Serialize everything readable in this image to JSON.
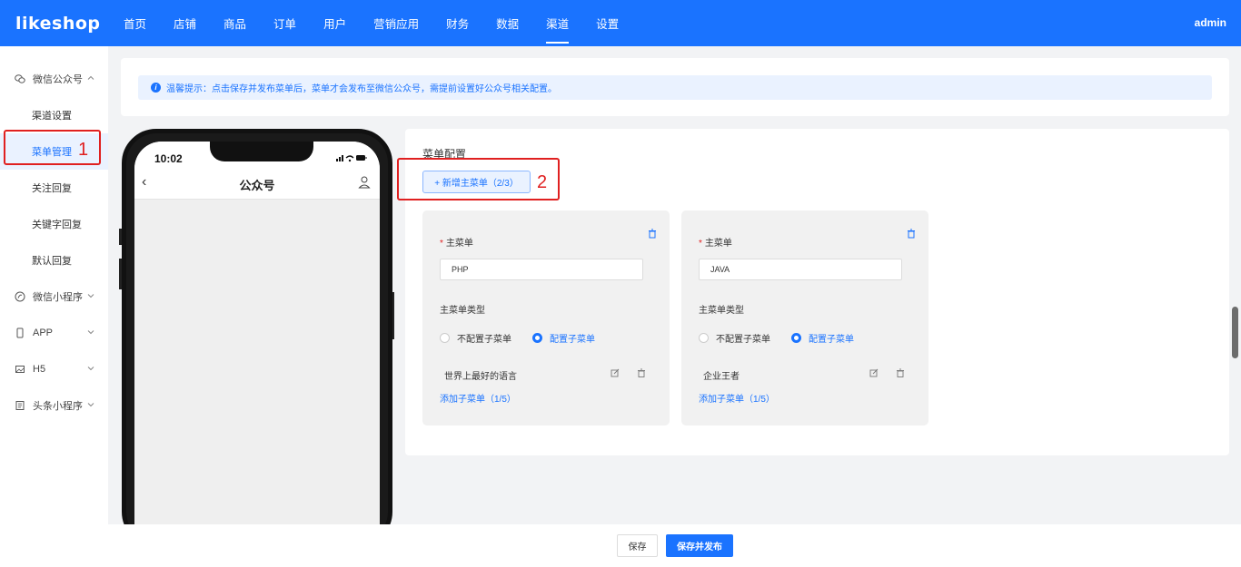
{
  "logo": "likeshop",
  "nav": [
    "首页",
    "店铺",
    "商品",
    "订单",
    "用户",
    "营销应用",
    "财务",
    "数据",
    "渠道",
    "设置"
  ],
  "nav_active": 8,
  "user": "admin",
  "sidebar": {
    "group_wechat_oa": "微信公众号",
    "items": [
      "渠道设置",
      "菜单管理",
      "关注回复",
      "关键字回复",
      "默认回复"
    ],
    "active": 1,
    "group_mini": "微信小程序",
    "group_app": "APP",
    "group_h5": "H5",
    "group_toutiao": "头条小程序"
  },
  "notice": "温馨提示：点击保存并发布菜单后，菜单才会发布至微信公众号，需提前设置好公众号相关配置。",
  "phone": {
    "time": "10:02",
    "title": "公众号",
    "back": "‹"
  },
  "config": {
    "title": "菜单配置",
    "add_button": "+ 新增主菜单（2/3）",
    "cards": [
      {
        "label": "主菜单",
        "value": "PHP",
        "type_label": "主菜单类型",
        "radio_no_sub": "不配置子菜单",
        "radio_sub": "配置子菜单",
        "sub_item": "世界上最好的语言",
        "add_sub": "添加子菜单（1/5）"
      },
      {
        "label": "主菜单",
        "value": "JAVA",
        "type_label": "主菜单类型",
        "radio_no_sub": "不配置子菜单",
        "radio_sub": "配置子菜单",
        "sub_item": "企业王者",
        "add_sub": "添加子菜单（1/5）"
      }
    ]
  },
  "annotations": {
    "marker_1": "1",
    "marker_2": "2"
  },
  "bottom": {
    "save": "保存",
    "publish": "保存并发布"
  },
  "colors": {
    "primary": "#1a73ff",
    "annotation": "#e02020"
  }
}
